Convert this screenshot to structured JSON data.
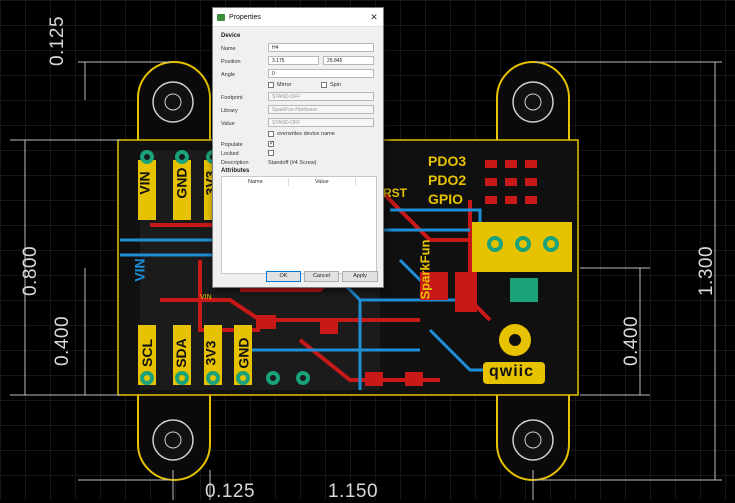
{
  "dimensions": {
    "top_left": "0.125",
    "left_outer": "0.800",
    "left_inner": "0.400",
    "right_outer": "1.300",
    "right_inner": "0.400",
    "bottom_left": "0.125",
    "bottom_center": "1.150"
  },
  "silkscreen": {
    "pins_top": [
      "VIN",
      "GND",
      "3V3"
    ],
    "pins_bottom": [
      "SCL",
      "SDA",
      "3V3",
      "GND"
    ],
    "pdo_labels": [
      "PDO3",
      "PDO2",
      "GPIO"
    ],
    "reset_label": "RST",
    "qwiic_logo": "qwiic",
    "left_vertical": "VIN",
    "vin_small": "VIN",
    "brand": "SparkFun"
  },
  "dialog": {
    "title": "Properties",
    "device_section": "Device",
    "name_label": "Name",
    "name_value": "H4",
    "position_label": "Position",
    "position_x": "3.175",
    "position_y": "29.845",
    "angle_label": "Angle",
    "angle_value": "0",
    "mirror_label": "Mirror",
    "spin_label": "Spin",
    "footprint_label": "Footprint",
    "footprint_value": "STAND-OFF",
    "library_label": "Library",
    "library_value": "SparkFun-Hardware",
    "value_label": "Value",
    "value_value": "STAND-OFF",
    "overwrite_label": "overwrites device name",
    "populate_label": "Populate",
    "populate_checked": "✓",
    "locked_label": "Locked",
    "description_label": "Description",
    "description_value": "Standoff (#4 Screw)",
    "attributes_section": "Attributes",
    "attr_col_name": "Name",
    "attr_col_value": "Value",
    "ok_label": "OK",
    "cancel_label": "Cancel",
    "apply_label": "Apply"
  }
}
